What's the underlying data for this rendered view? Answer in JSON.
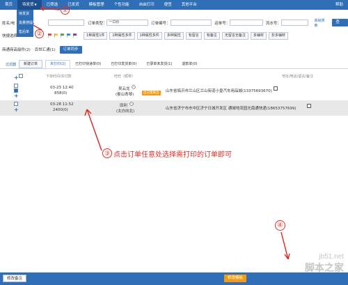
{
  "topnav": {
    "items": [
      "首页",
      "待发货",
      "已筛选",
      "已发货",
      "模板管理",
      "个性功能",
      "自由打印",
      "便签",
      "其他平台"
    ],
    "help": "帮助"
  },
  "dropdown": {
    "items": [
      "待发货",
      "批量搜提示",
      "售后单"
    ]
  },
  "search": {
    "name_label": "姓名/电",
    "order_type_label": "订单类型：",
    "order_type_value": "一口价",
    "order_no_label": "订单编号：",
    "logistics_label": "运单号：",
    "serial_label": "流水号：",
    "advanced_link": "高级搜索",
    "search_button": "查 询"
  },
  "quick": {
    "label": "快捷选择",
    "flag_colors": [
      "#e53935",
      "#fbc02d",
      "#43a047",
      "#1e88e5",
      "#8e24aa"
    ],
    "buttons": [
      "1种属性1件",
      "1种属性多件",
      "1种属性多件",
      "多种属性",
      "有留言",
      "有备注",
      "无留言无备注",
      "多辅材",
      "非多辅材"
    ]
  },
  "bind": {
    "left_label": "商通商高级件(2)",
    "right_label": "百世汇通(1)",
    "sync_button": "订单同步"
  },
  "tabs": {
    "filter_link": "过滤器",
    "new_order_button": "新建订单",
    "items": [
      "未打印(2)",
      "已打印快递单(0)",
      "已打印发货单(0)",
      "已录单未发货(1)",
      "退款单(0)"
    ],
    "active_index": 0
  },
  "table": {
    "headers": [
      "下单时间/实付款",
      "旺旺（昵称）",
      "地址/电话/留言/备注"
    ],
    "rows": [
      {
        "time": "03-23 12:40",
        "pay": "858(0)",
        "buyer": "吴云龙",
        "buyer_sub": "(娄山青琴)",
        "badge": "自己帮来出",
        "address": "山东省临沂市兰山区兰山街道小皇汽车用品城(13375693670)",
        "checked": true
      },
      {
        "time": "03-28 11:52",
        "pay": "2400(0)",
        "buyer": "田利",
        "buyer_sub": "(太白向北)",
        "badge": "",
        "address": "山东省济宁市市中区济宁日城开发区 通城地流园光南通快递(18653757699)",
        "checked": false
      }
    ]
  },
  "annotations": {
    "marks": [
      "①",
      "②",
      "③",
      "④"
    ],
    "instruction": "点击订单任意处选择需打印的订单即可",
    "color": "#d9302a"
  },
  "bottom": {
    "left_button": "修改备注",
    "right_button": "修改模板"
  },
  "watermark": {
    "url": "jb51.net",
    "name": "脚本之家"
  },
  "colors": {
    "nav_blue": "#2f6fb7",
    "accent_orange": "#f39c12"
  }
}
